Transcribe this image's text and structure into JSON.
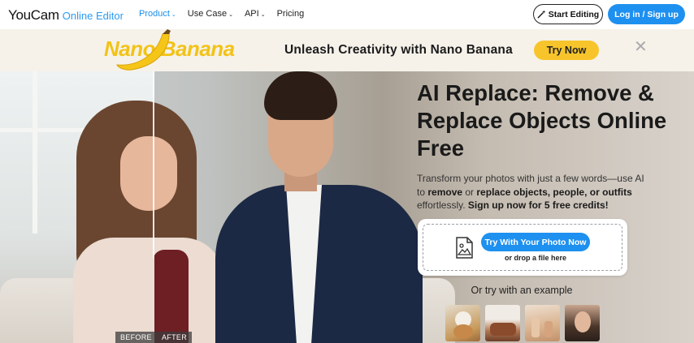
{
  "nav": {
    "logo_main": "YouCam",
    "logo_sub": "Online Editor",
    "menu": [
      {
        "label": "Product",
        "has_dropdown": true,
        "active": true
      },
      {
        "label": "Use Case",
        "has_dropdown": true,
        "active": false
      },
      {
        "label": "API",
        "has_dropdown": true,
        "active": false
      },
      {
        "label": "Pricing",
        "has_dropdown": false,
        "active": false
      }
    ],
    "start_editing": "Start Editing",
    "login": "Log in / Sign up",
    "start_icon": "magic-wand-icon"
  },
  "banner": {
    "logo_text": "Nano Banana",
    "headline": "Unleash Creativity with Nano Banana",
    "cta": "Try Now",
    "close_icon": "close-icon"
  },
  "hero": {
    "title": "AI Replace: Remove & Replace Objects Online Free",
    "desc_part1": "Transform your photos with just a few words—use AI to ",
    "desc_bold1": "remove",
    "desc_part2": " or ",
    "desc_bold2": "replace objects, people, or outfits",
    "desc_part3": " effortlessly. ",
    "desc_bold3": "Sign up now for 5 free credits!",
    "before_label": "BEFORE",
    "after_label": "AFTER",
    "upload_button": "Try With Your Photo Now",
    "drop_text": "or drop a file here",
    "examples_heading": "Or try with an example"
  },
  "colors": {
    "accent": "#1e90ef",
    "banner_yellow": "#f7c52b",
    "banner_bg": "#f6f2ea"
  }
}
